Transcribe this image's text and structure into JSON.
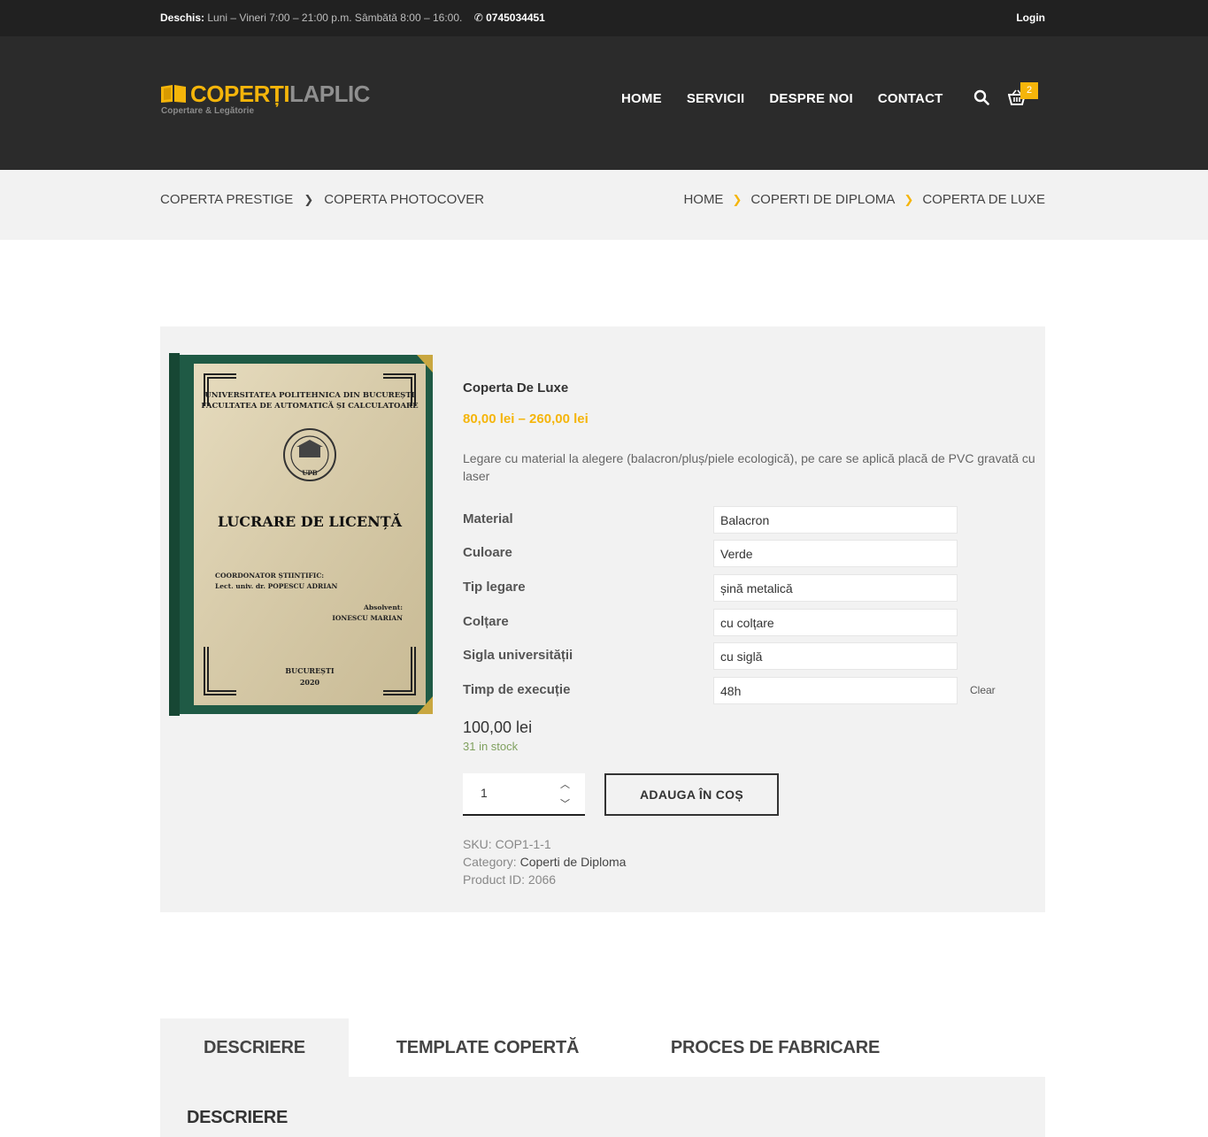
{
  "topbar": {
    "open_label": "Deschis:",
    "hours": "Luni – Vineri 7:00 – 21:00 p.m. Sâmbătă 8:00 – 16:00.",
    "phone": "0745034451",
    "login": "Login"
  },
  "logo": {
    "brand_a": "COPERȚI",
    "brand_b": "LAPLIC",
    "tagline": "Copertare & Legătorie"
  },
  "nav": [
    "HOME",
    "SERVICII",
    "DESPRE NOI",
    "CONTACT"
  ],
  "cart": {
    "count": "2"
  },
  "breadcrumb_left": [
    "COPERTA PRESTIGE",
    "COPERTA PHOTOCOVER"
  ],
  "breadcrumb_right": [
    "HOME",
    "COPERTI DE DIPLOMA",
    "COPERTA DE LUXE"
  ],
  "cover": {
    "univ_line1": "UNIVERSITATEA POLITEHNICA DIN BUCUREȘTI",
    "univ_line2": "FACULTATEA DE AUTOMATICĂ ȘI CALCULATOARE",
    "title": "LUCRARE DE LICENȚĂ",
    "coord_label": "COORDONATOR ȘTIINȚIFIC:",
    "coord_name": "Lect. univ. dr. POPESCU ADRIAN",
    "abs_label": "Absolvent:",
    "abs_name": "IONESCU MARIAN",
    "city": "BUCUREȘTI",
    "year": "2020",
    "seal": "UPB"
  },
  "product": {
    "title": "Coperta De Luxe",
    "price_range": "80,00 lei – 260,00 lei",
    "description": "Legare cu material la alegere (balacron/pluș/piele ecologică), pe care se aplică placă de PVC gravată cu laser",
    "variations": [
      {
        "label": "Material",
        "value": "Balacron"
      },
      {
        "label": "Culoare",
        "value": "Verde"
      },
      {
        "label": "Tip legare",
        "value": "șină metalică"
      },
      {
        "label": "Colțare",
        "value": "cu colțare"
      },
      {
        "label": "Sigla universității",
        "value": "cu siglă"
      },
      {
        "label": "Timp de execuție",
        "value": "48h"
      }
    ],
    "clear": "Clear",
    "variation_price": "100,00 lei",
    "stock": "31 in stock",
    "quantity": "1",
    "add_to_cart": "ADAUGA ÎN COȘ",
    "sku_label": "SKU:",
    "sku": "COP1-1-1",
    "category_label": "Category:",
    "category": "Coperti de Diploma",
    "product_id_label": "Product ID:",
    "product_id": "2066"
  },
  "tabs": [
    "DESCRIERE",
    "TEMPLATE COPERTĂ",
    "PROCES DE FABRICARE"
  ],
  "tab_heading": "DESCRIERE",
  "colors": {
    "accent": "#f5b50a",
    "header": "#2b2b2b",
    "topbar": "#212121",
    "cover_green": "#1f5a45"
  },
  "icons": [
    "phone-icon",
    "search-icon",
    "cart-icon",
    "chevron-right-icon",
    "chevron-up-icon",
    "chevron-down-icon",
    "book-logo-icon"
  ]
}
